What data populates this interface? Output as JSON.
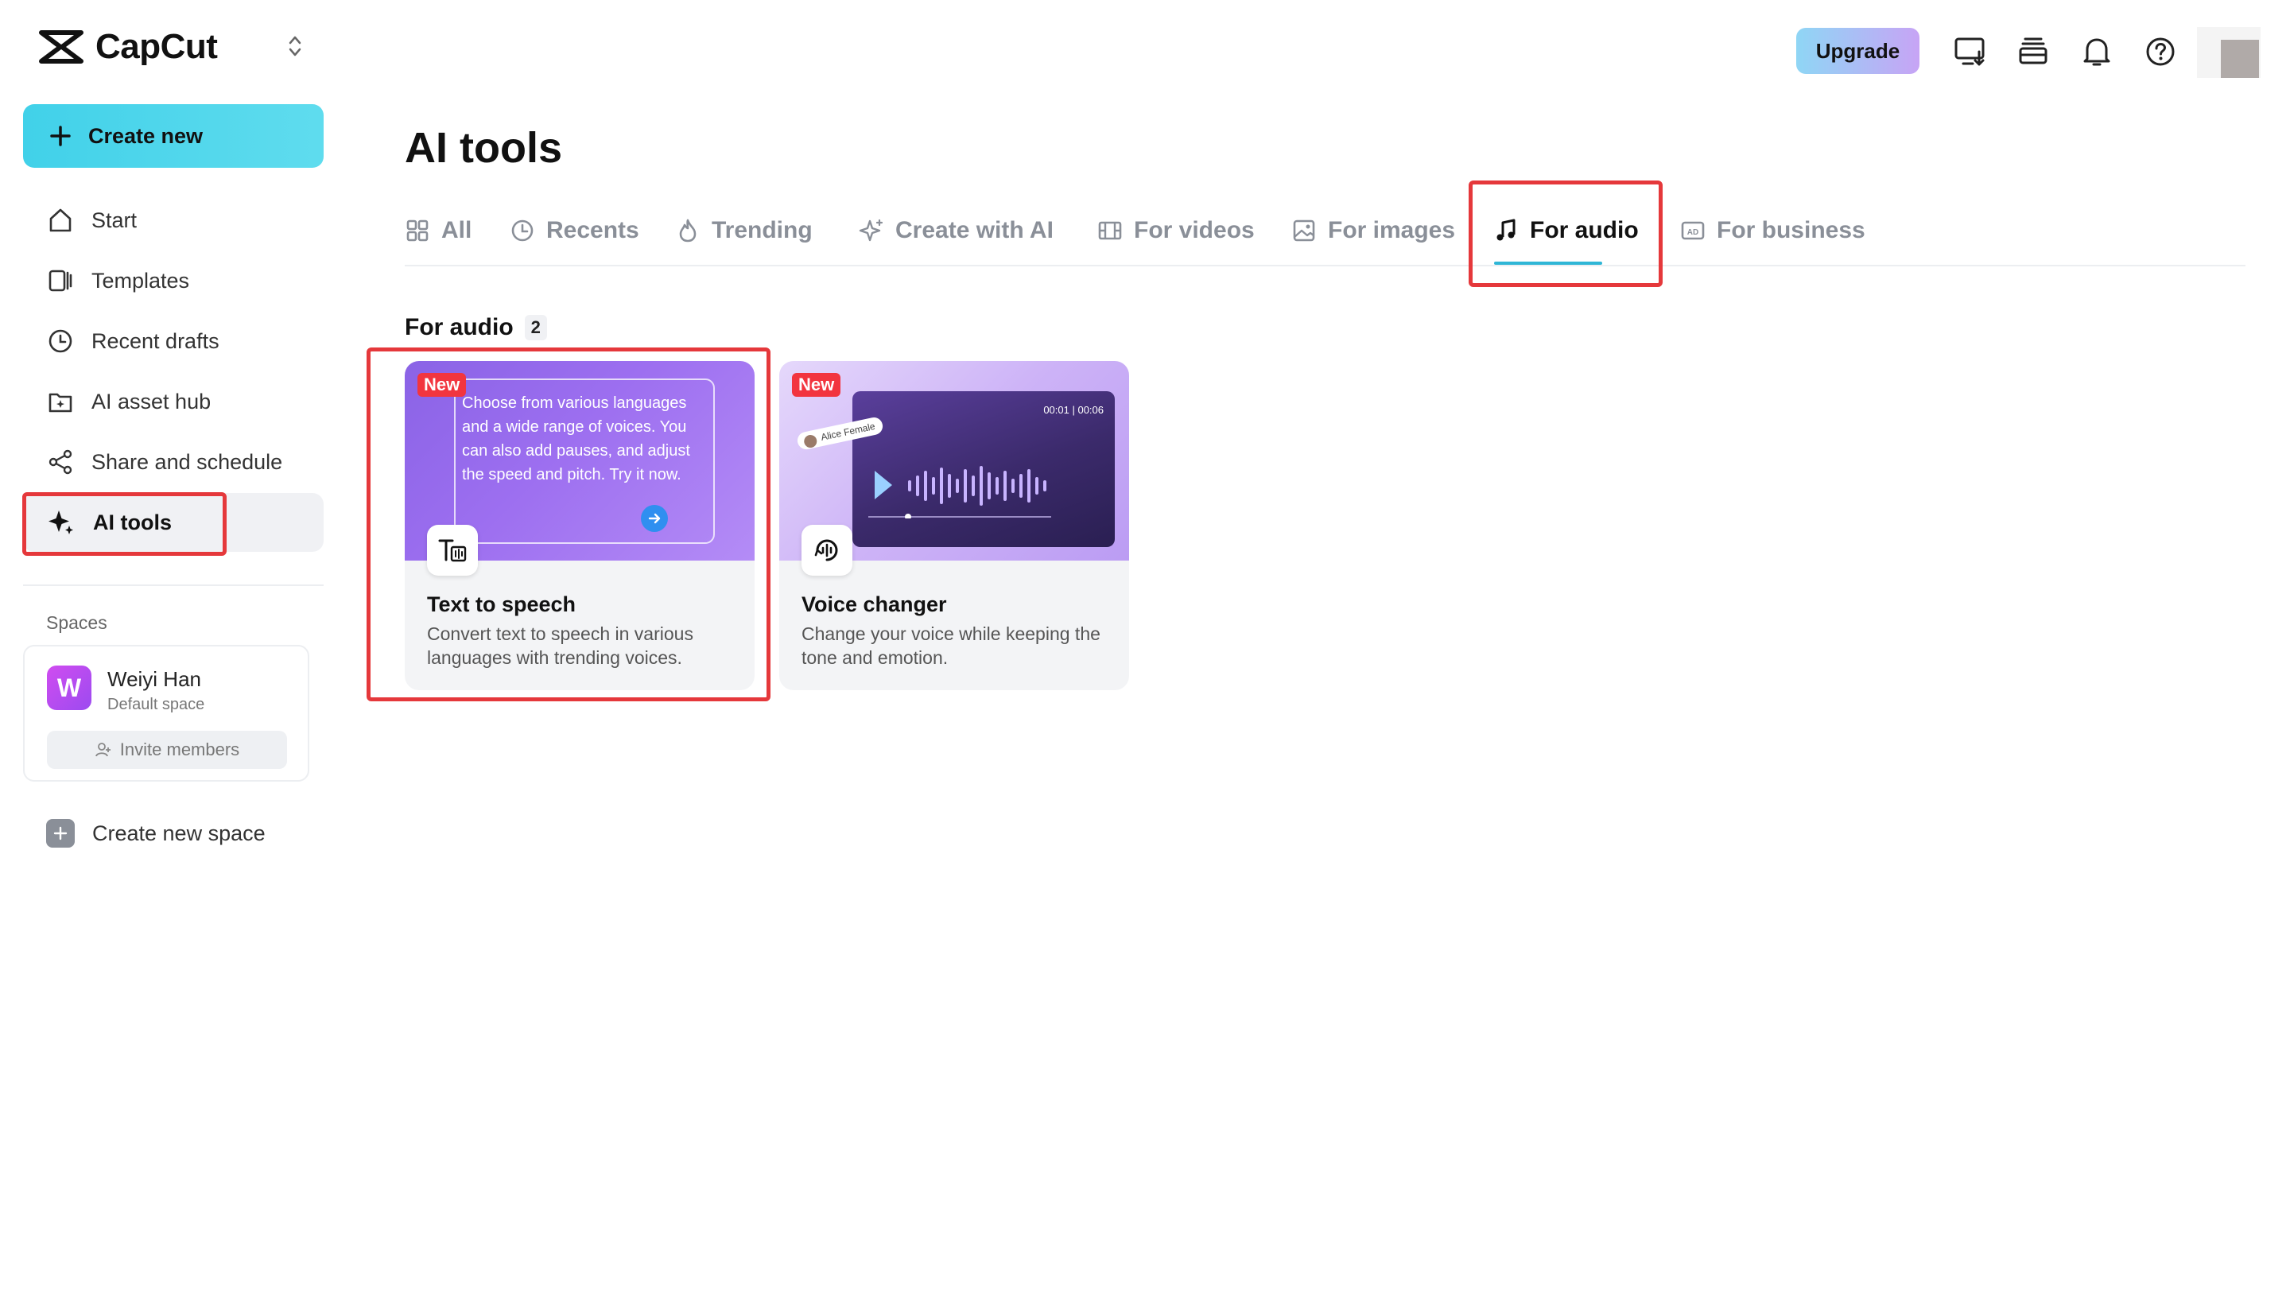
{
  "app": {
    "name": "CapCut"
  },
  "sidebar": {
    "create_label": "Create new",
    "items": [
      {
        "label": "Start",
        "icon": "home-icon"
      },
      {
        "label": "Templates",
        "icon": "templates-icon"
      },
      {
        "label": "Recent drafts",
        "icon": "clock-icon"
      },
      {
        "label": "AI asset hub",
        "icon": "asset-hub-icon"
      },
      {
        "label": "Share and schedule",
        "icon": "share-icon"
      },
      {
        "label": "AI tools",
        "icon": "sparkle-icon",
        "active": true
      }
    ],
    "spaces_label": "Spaces",
    "space": {
      "initial": "W",
      "name": "Weiyi Han",
      "subtitle": "Default space",
      "invite_label": "Invite members"
    },
    "create_space_label": "Create new space"
  },
  "topbar": {
    "upgrade_label": "Upgrade",
    "icons": [
      "download-desktop-icon",
      "layers-icon",
      "bell-icon",
      "help-icon",
      "profile-avatar"
    ]
  },
  "main": {
    "title": "AI tools",
    "tabs": [
      {
        "label": "All",
        "icon": "grid-icon"
      },
      {
        "label": "Recents",
        "icon": "clock-icon"
      },
      {
        "label": "Trending",
        "icon": "flame-icon"
      },
      {
        "label": "Create with AI",
        "icon": "sparkle-icon"
      },
      {
        "label": "For videos",
        "icon": "film-icon"
      },
      {
        "label": "For images",
        "icon": "image-icon"
      },
      {
        "label": "For audio",
        "icon": "music-note-icon",
        "active": true
      },
      {
        "label": "For business",
        "icon": "ad-icon"
      }
    ],
    "section": {
      "title": "For audio",
      "count": "2"
    },
    "cards": [
      {
        "badge": "New",
        "title": "Text to speech",
        "description": "Convert text to speech in various languages with trending voices.",
        "preview_text": "Choose from various languages and a wide range of voices. You can also add pauses, and adjust the speed and pitch. Try it now.",
        "icon": "text-to-speech-icon"
      },
      {
        "badge": "New",
        "title": "Voice changer",
        "description": "Change your voice while keeping the tone and emotion.",
        "preview_voice": "Alice Female",
        "preview_time": "00:01 | 00:06",
        "icon": "voice-changer-icon"
      }
    ]
  },
  "colors": {
    "accent": "#2fb6d6",
    "create_gradient": "#41d1e9",
    "highlight": "#e5383b",
    "badge": "#f2353f"
  }
}
